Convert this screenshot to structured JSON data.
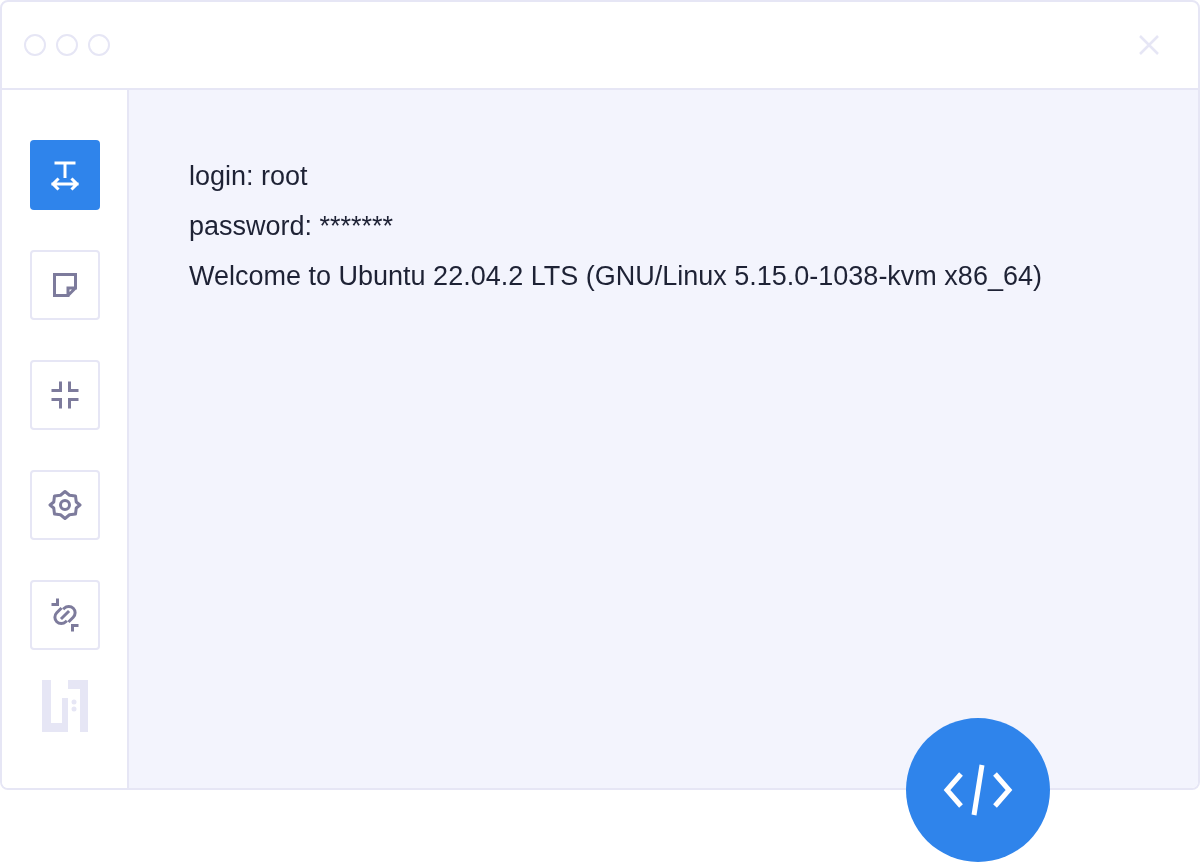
{
  "sidebar": {
    "tools": [
      {
        "kind": "text-width",
        "selected": true
      },
      {
        "kind": "note",
        "selected": false
      },
      {
        "kind": "collapse",
        "selected": false
      },
      {
        "kind": "settings",
        "selected": false
      },
      {
        "kind": "unlink",
        "selected": false
      }
    ]
  },
  "terminal": {
    "lines": [
      "login: root",
      "password: *******",
      "Welcome to Ubuntu 22.04.2 LTS (GNU/Linux 5.15.0-1038-kvm x86_64)"
    ]
  }
}
